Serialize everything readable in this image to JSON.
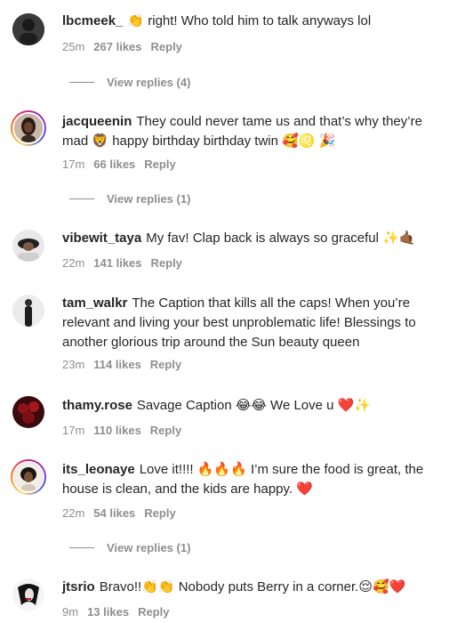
{
  "comments": [
    {
      "username": "lbcmeek_",
      "text": "👏 right! Who told him to talk anyways lol",
      "time": "25m",
      "likes": "267 likes",
      "reply": "Reply",
      "view_replies": "View replies (4)"
    },
    {
      "username": "jacqueenin",
      "text": "They could never tame us and that’s why they’re mad 🦁 happy birthday birthday twin 🥰♌️ 🎉",
      "time": "17m",
      "likes": "66 likes",
      "reply": "Reply",
      "view_replies": "View replies (1)"
    },
    {
      "username": "vibewit_taya",
      "text": "My fav! Clap back is always so graceful ✨🤙🏾",
      "time": "22m",
      "likes": "141 likes",
      "reply": "Reply"
    },
    {
      "username": "tam_walkr",
      "text": "The Caption that kills all the caps! When you’re relevant and living your best unproblematic life! Blessings to another glorious trip around the Sun beauty queen",
      "time": "23m",
      "likes": "114 likes",
      "reply": "Reply"
    },
    {
      "username": "thamy.rose",
      "text": "Savage Caption 😂😂 We Love u ❤️✨",
      "time": "17m",
      "likes": "110 likes",
      "reply": "Reply"
    },
    {
      "username": "its_leonaye",
      "text": "Love it!!!! 🔥🔥🔥 I’m sure the food is great, the house is clean, and the kids are happy. ❤️",
      "time": "22m",
      "likes": "54 likes",
      "reply": "Reply",
      "view_replies": "View replies (1)"
    },
    {
      "username": "jtsrio",
      "text": "Bravo!!👏👏 Nobody puts Berry in a corner.😌🥰❤️",
      "time": "9m",
      "likes": "13 likes",
      "reply": "Reply"
    }
  ]
}
